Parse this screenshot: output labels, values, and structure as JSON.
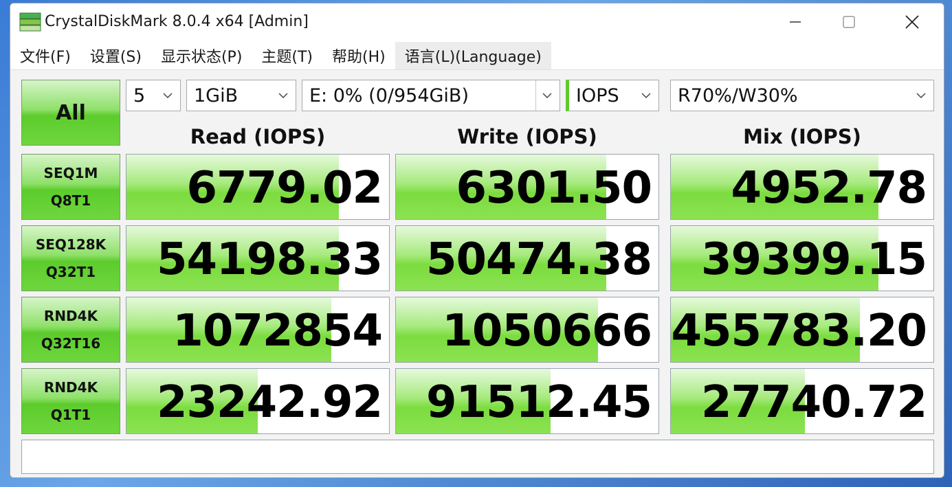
{
  "window": {
    "title": "CrystalDiskMark 8.0.4 x64 [Admin]"
  },
  "menu": {
    "items": [
      "文件(F)",
      "设置(S)",
      "显示状态(P)",
      "主题(T)",
      "帮助(H)",
      "语言(L)(Language)"
    ]
  },
  "controls": {
    "all_label": "All",
    "count": "5",
    "size": "1GiB",
    "drive": "E: 0% (0/954GiB)",
    "unit": "IOPS",
    "mix": "R70%/W30%"
  },
  "columns": [
    "Read (IOPS)",
    "Write (IOPS)",
    "Mix (IOPS)"
  ],
  "rows": [
    {
      "line1": "SEQ1M",
      "line2": "Q8T1",
      "values": [
        "6779.02",
        "6301.50",
        "4952.78"
      ],
      "fills": [
        0.81,
        0.8,
        0.79
      ]
    },
    {
      "line1": "SEQ128K",
      "line2": "Q32T1",
      "values": [
        "54198.33",
        "50474.38",
        "39399.15"
      ],
      "fills": [
        0.81,
        0.8,
        0.79
      ]
    },
    {
      "line1": "RND4K",
      "line2": "Q32T16",
      "values": [
        "1072854",
        "1050666",
        "455783.20"
      ],
      "fills": [
        0.78,
        0.77,
        0.72
      ]
    },
    {
      "line1": "RND4K",
      "line2": "Q1T1",
      "values": [
        "23242.92",
        "91512.45",
        "27740.72"
      ],
      "fills": [
        0.5,
        0.59,
        0.51
      ]
    }
  ],
  "status_text": ""
}
